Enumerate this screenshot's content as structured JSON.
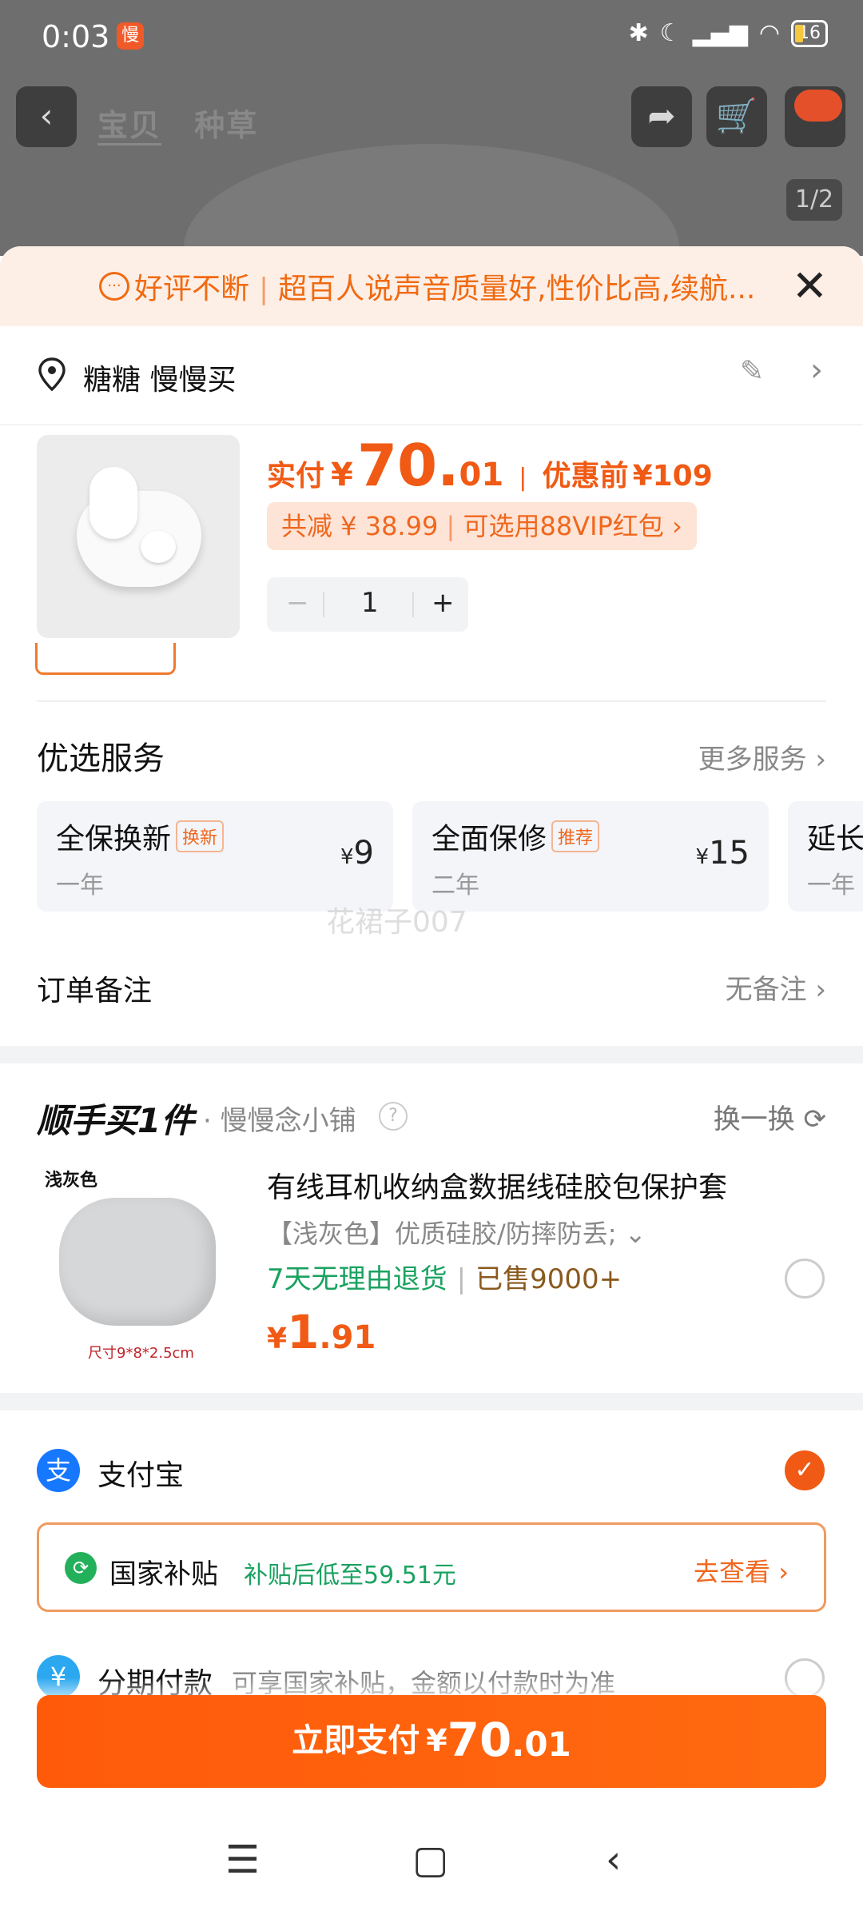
{
  "status_bar": {
    "time": "0:03",
    "slow_badge": "慢",
    "battery": "16"
  },
  "top_nav": {
    "tab_1": "宝贝",
    "tab_2": "种草",
    "pager": "1/2"
  },
  "banner": {
    "label": "好评不断",
    "text": "超百人说声音质量好,性价比高,续航..."
  },
  "address": {
    "name": "糖糖 慢慢买"
  },
  "product": {
    "pay_label": "实付",
    "currency": "¥",
    "price_int": "70.",
    "price_dec": "01",
    "orig_label": "优惠前",
    "orig_price": "¥109",
    "saving_text": "共减 ¥ 38.99",
    "vip_text": "可选用88VIP红包",
    "quantity": "1",
    "minus": "−",
    "plus": "+"
  },
  "services": {
    "title": "优选服务",
    "more": "更多服务",
    "cards": [
      {
        "title": "全保换新",
        "tag": "换新",
        "sub": "一年",
        "yen": "¥",
        "price": "9"
      },
      {
        "title": "全面保修",
        "tag": "推荐",
        "sub": "二年",
        "yen": "¥",
        "price": "15"
      },
      {
        "title": "延长",
        "sub": "一年"
      }
    ]
  },
  "watermark": "花裙子007",
  "order_note": {
    "label": "订单备注",
    "value": "无备注"
  },
  "bundle": {
    "title": "顺手买1件",
    "shop": "慢慢念小铺",
    "swap": "换一换",
    "item": {
      "img_label": "浅灰色",
      "img_size": "尺寸9*8*2.5cm",
      "title": "有线耳机收纳盒数据线硅胶包保护套",
      "spec": "【浅灰色】优质硅胶/防摔防丢;",
      "return_policy": "7天无理由退货",
      "sold": "已售9000+",
      "currency": "¥",
      "price_int": "1",
      "price_dec": ".91"
    }
  },
  "payment": {
    "alipay": "支付宝",
    "subsidy_title": "国家补贴",
    "subsidy_text": "补贴后低至59.51元",
    "subsidy_go": "去查看",
    "installment": "分期付款",
    "installment_sub": "可享国家补贴，金额以付款时为准"
  },
  "pay_button": {
    "label": "立即支付",
    "currency": "¥",
    "price_int": "70",
    "price_dec": ".01"
  },
  "colors": {
    "accent": "#f05a14",
    "green": "#1aa260"
  }
}
